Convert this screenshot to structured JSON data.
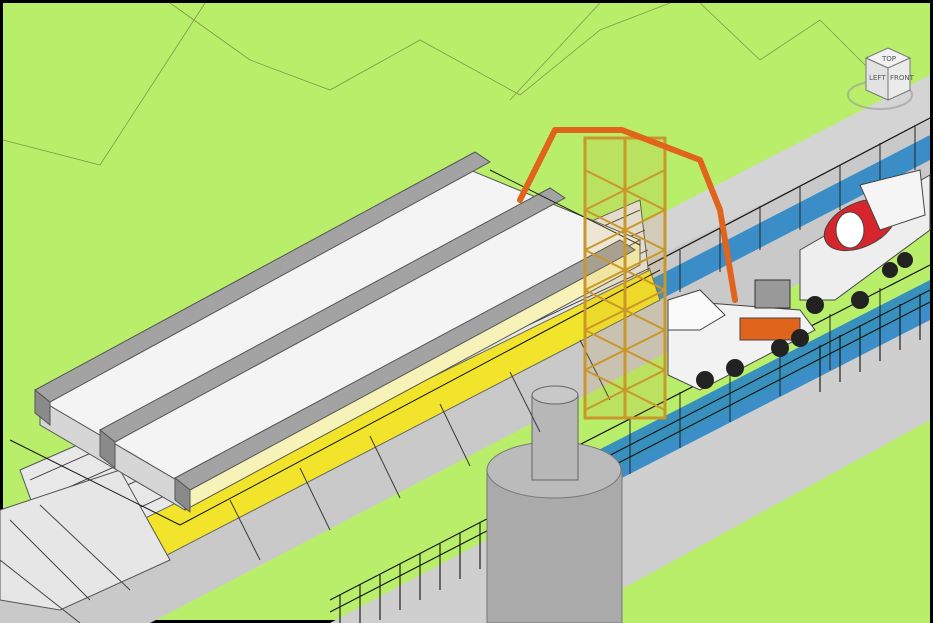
{
  "viewport": {
    "scene": "bim-model-view"
  },
  "viewcube": {
    "top_label": "TOP",
    "left_label": "LEFT",
    "front_label": "FRONT"
  },
  "colors": {
    "ground_green": "#b9ee6b",
    "road_gray": "#c9c9c9",
    "fence_blue": "#2a86c7",
    "boom_orange": "#e0641b",
    "truss_gold": "#c9972a",
    "mixer_red": "#d6252c",
    "girder_gray": "#9a9a9a",
    "walkway_yellow": "#f2e42a",
    "frame_black": "#000000"
  },
  "icons": {
    "viewcube": "viewcube-icon",
    "compass": "compass-ring-icon"
  }
}
